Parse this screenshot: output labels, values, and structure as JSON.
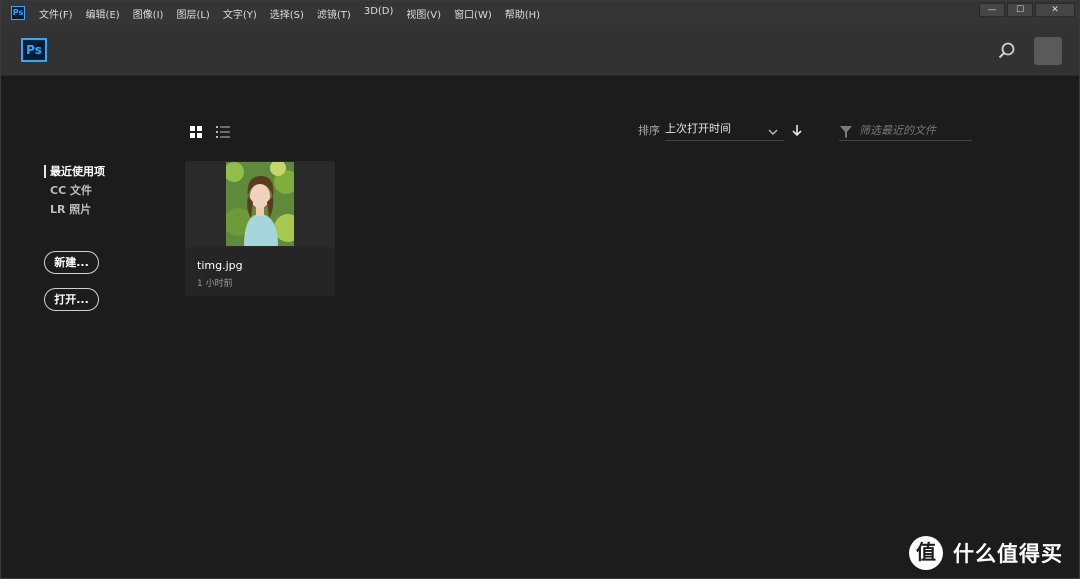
{
  "window": {
    "app_icon": "Ps",
    "menu": [
      "文件(F)",
      "编辑(E)",
      "图像(I)",
      "图层(L)",
      "文字(Y)",
      "选择(S)",
      "滤镜(T)",
      "3D(D)",
      "视图(V)",
      "窗口(W)",
      "帮助(H)"
    ],
    "controls": {
      "minimize": "—",
      "maximize": "☐",
      "close": "✕"
    }
  },
  "header": {
    "logo": "Ps",
    "search_icon": "search-icon",
    "avatar_icon": "avatar-icon"
  },
  "sidebar": {
    "items": [
      {
        "label": "最近使用项",
        "active": true
      },
      {
        "label": "CC 文件",
        "active": false
      },
      {
        "label": "LR 照片",
        "active": false
      }
    ],
    "new_button": "新建...",
    "open_button": "打开..."
  },
  "toolbar": {
    "grid_view_icon": "grid-view-icon",
    "list_view_icon": "list-view-icon",
    "sort_label": "排序",
    "sort_value": "上次打开时间",
    "sort_direction_icon": "arrow-down-icon",
    "filter_placeholder": "筛选最近的文件"
  },
  "files": [
    {
      "name": "timg.jpg",
      "opened": "1 小时前"
    }
  ],
  "watermark": {
    "badge": "值",
    "text": "什么值得买"
  },
  "colors": {
    "accent": "#31a8ff",
    "background": "#1c1c1c",
    "header": "#323232",
    "card": "#252525"
  }
}
